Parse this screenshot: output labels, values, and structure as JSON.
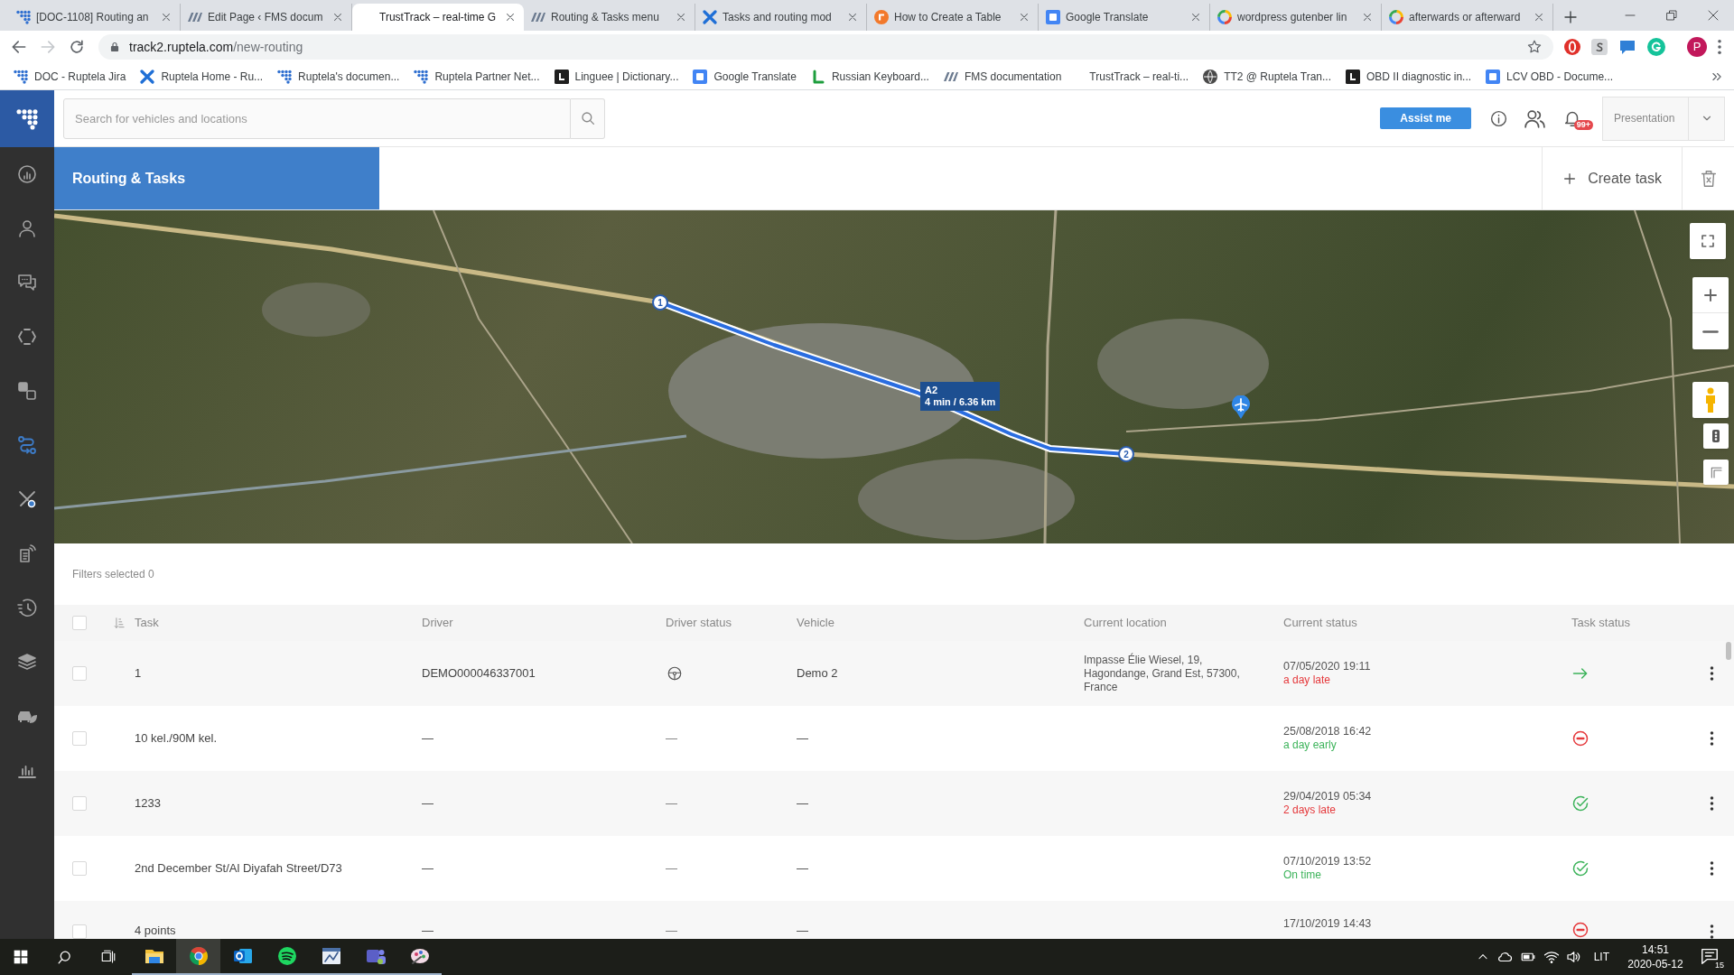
{
  "browser_tabs": [
    {
      "title": "[DOC-1108] Routing an",
      "selected": false
    },
    {
      "title": "Edit Page ‹ FMS docum",
      "selected": false
    },
    {
      "title": "TrustTrack – real-time G",
      "selected": true
    },
    {
      "title": "Routing & Tasks menu",
      "selected": false
    },
    {
      "title": "Tasks and routing mod",
      "selected": false
    },
    {
      "title": "How to Create a Table",
      "selected": false
    },
    {
      "title": "Google Translate",
      "selected": false
    },
    {
      "title": "wordpress gutenber lin",
      "selected": false
    },
    {
      "title": "afterwards or afterward",
      "selected": false
    }
  ],
  "address_bar": {
    "back_disabled": false,
    "forward_disabled": true,
    "domain": "track2.ruptela.com",
    "path": "/new-routing",
    "profile_initial": "P"
  },
  "bookmarks": [
    "DOC - Ruptela Jira",
    "Ruptela Home - Ru...",
    "Ruptela's documen...",
    "Ruptela Partner Net...",
    "Linguee | Dictionary...",
    "Google Translate",
    "Russian Keyboard...",
    "FMS documentation",
    "TrustTrack – real-ti...",
    "TT2 @ Ruptela Tran...",
    "OBD II diagnostic in...",
    "LCV OBD - Docume..."
  ],
  "header": {
    "search": {
      "placeholder": "Search for vehicles and locations"
    },
    "assist_button": "Assist me",
    "notification_badge": "99+",
    "account_menu": "Presentation"
  },
  "sidebar": {
    "items": [
      {
        "selected": false
      },
      {
        "selected": false
      },
      {
        "selected": false
      },
      {
        "selected": false
      },
      {
        "selected": false
      },
      {
        "selected": true
      },
      {
        "selected": false
      },
      {
        "selected": false
      },
      {
        "selected": false
      },
      {
        "selected": false
      },
      {
        "selected": false
      },
      {
        "selected": false
      }
    ]
  },
  "page_header": {
    "title": "Routing & Tasks",
    "create_button": "Create task"
  },
  "map": {
    "route": {
      "start_marker": "1",
      "end_marker": "2",
      "road": "A2",
      "eta": "4 min / 6.36 km"
    }
  },
  "filters": {
    "summary": "Filters selected 0"
  },
  "table": {
    "all_checked": false,
    "columns": [
      "Task",
      "Driver",
      "Driver status",
      "Vehicle",
      "Current location",
      "Current status",
      "Task status"
    ],
    "rows": [
      {
        "checked": false,
        "task": "1",
        "driver": "DEMO000046337001",
        "driver_status": {
          "kind": "driving"
        },
        "vehicle": "Demo 2",
        "location": "Impasse Élie Wiesel, 19, Hagondange, Grand Est, 57300, France",
        "time": "07/05/2020 19:11",
        "delay": {
          "text": "a day late",
          "color": "#e5383b"
        },
        "task_status": {
          "kind": "in_progress"
        }
      },
      {
        "checked": false,
        "task": "10 kel./90M kel.",
        "driver": "—",
        "driver_status": {
          "kind": "text",
          "text": "—"
        },
        "vehicle": "—",
        "time": "25/08/2018 16:42",
        "delay": {
          "text": "a day early",
          "color": "#3cb35a"
        },
        "task_status": {
          "kind": "cancelled"
        }
      },
      {
        "checked": false,
        "task": "1233",
        "driver": "—",
        "driver_status": {
          "kind": "text",
          "text": "—"
        },
        "vehicle": "—",
        "time": "29/04/2019 05:34",
        "delay": {
          "text": "2 days late",
          "color": "#e5383b"
        },
        "task_status": {
          "kind": "completed"
        }
      },
      {
        "checked": false,
        "task": "2nd December St/Al Diyafah Street/D73",
        "driver": "—",
        "driver_status": {
          "kind": "text",
          "text": "—"
        },
        "vehicle": "—",
        "time": "07/10/2019 13:52",
        "delay": {
          "text": "On time",
          "color": "#3cb35a"
        },
        "task_status": {
          "kind": "completed"
        }
      },
      {
        "checked": false,
        "task": "4 points",
        "driver": "—",
        "driver_status": {
          "kind": "text",
          "text": "—"
        },
        "vehicle": "—",
        "time": "17/10/2019 14:43",
        "task_status": {
          "kind": "cancelled"
        }
      }
    ]
  },
  "taskbar": {
    "apps": [
      {
        "open": true,
        "selected": false
      },
      {
        "open": true,
        "selected": true
      },
      {
        "open": true,
        "selected": false
      },
      {
        "open": true,
        "selected": false
      },
      {
        "open": true,
        "selected": false
      },
      {
        "open": true,
        "selected": false
      },
      {
        "open": true,
        "selected": false
      }
    ],
    "language": "LIT",
    "time": "14:51",
    "date": "2020-05-12",
    "notification_count": "15"
  }
}
